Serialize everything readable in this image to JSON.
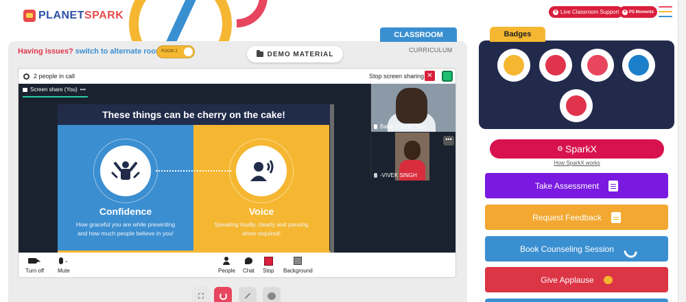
{
  "brand": {
    "logo_text_a": "PLANET",
    "logo_text_b": "SPARK"
  },
  "header": {
    "live_support": "Live Classroom Support",
    "ps_moments": "PS Moments",
    "menu_colors": [
      "#e8455f",
      "#f5b731",
      "#3a8fd1"
    ]
  },
  "classroom": {
    "tab_classroom": "CLASSROOM",
    "tab_curriculum": "CURRICULUM",
    "issues_text": "Having issues?",
    "alternate_link": "switch to alternate room",
    "room_toggle": "ROOM 2",
    "demo_material": "DEMO MATERIAL"
  },
  "meeting": {
    "people_count": "2 people in call",
    "stop_share": "Stop screen sharing",
    "share_label": "Screen share (You)",
    "share_more": "•••",
    "slide": {
      "heading": "These things can be cherry on the cake!",
      "left_title": "Confidence",
      "left_sub": "How graceful you are while presenting and how much people believe in you!",
      "right_title": "Voice",
      "right_sub": "Speaking loudly, clearly and pausing when required!"
    },
    "participants": [
      {
        "name": "Balaji Shinde (You)"
      },
      {
        "name": "-VIVEK SINGH"
      }
    ],
    "tile_more": "•••",
    "toolbar": {
      "turn_off": "Turn off",
      "mute": "Mute",
      "people": "People",
      "chat": "Chat",
      "stop": "Stop",
      "background": "Background"
    }
  },
  "badges": {
    "tab": "Badges",
    "core_colors": [
      "#f5b731",
      "#e0344c",
      "#e8455f",
      "#1c7fc9",
      "#e0344c"
    ]
  },
  "sparkx": {
    "label": "SparkX",
    "how": "How SparkX works"
  },
  "actions": [
    {
      "label": "Take Assessment",
      "color": "#7a1ae0"
    },
    {
      "label": "Request Feedback",
      "color": "#f2a831"
    },
    {
      "label": "Book Counseling Session",
      "color": "#3a8fd1"
    },
    {
      "label": "Give Applause",
      "color": "#dc3545"
    }
  ]
}
